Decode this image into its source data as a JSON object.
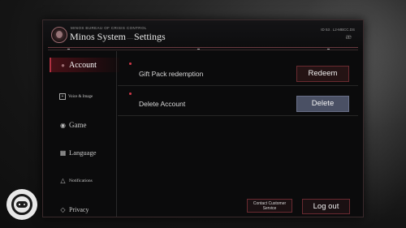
{
  "header": {
    "bureau": "MINOS BUREAU OF CRISIS CONTROL",
    "title_main": "Minos System",
    "title_sep": "——",
    "title_sub": "Settings",
    "code": "ID 53 . L2-MBCC.DS",
    "signature": "æ"
  },
  "sidebar": {
    "items": [
      {
        "label": "Account",
        "icon": "user-icon"
      },
      {
        "label": "Voice & Image",
        "icon": "image-icon"
      },
      {
        "label": "Game",
        "icon": "game-icon"
      },
      {
        "label": "Language",
        "icon": "language-icon"
      },
      {
        "label": "Notifications",
        "icon": "bell-icon"
      },
      {
        "label": "Privacy",
        "icon": "privacy-icon"
      }
    ]
  },
  "main": {
    "rows": [
      {
        "label": "Gift Pack redemption",
        "button": "Redeem"
      },
      {
        "label": "Delete Account",
        "button": "Delete"
      }
    ]
  },
  "footer": {
    "contact": "Contact Customer Service",
    "logout": "Log out"
  },
  "colors": {
    "accent_red": "#b03040",
    "delete_button": "#4a5064"
  }
}
